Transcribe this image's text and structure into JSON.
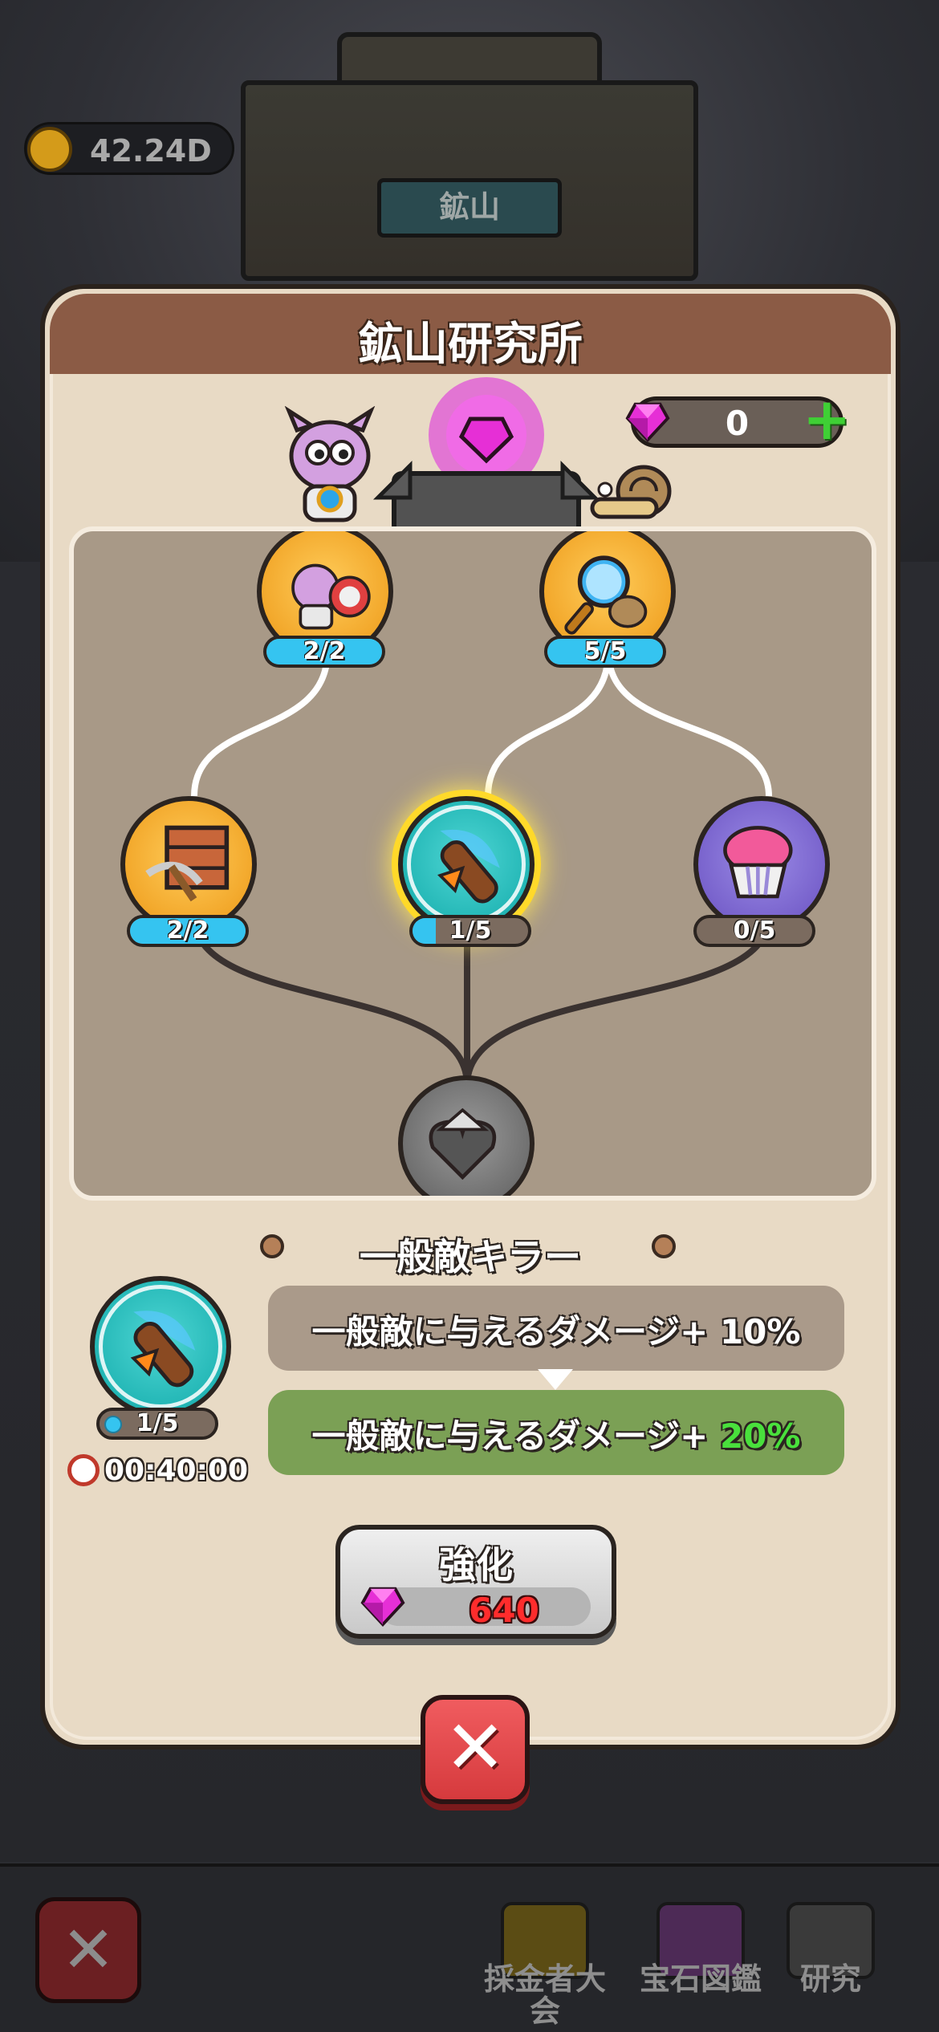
{
  "hud": {
    "coins": "42.24D",
    "mine_label": "鉱山"
  },
  "dialog": {
    "title": "鉱山研究所",
    "gem_count": "0"
  },
  "tree": {
    "nodes": [
      {
        "id": "worker-speed",
        "level": "2/2",
        "progress": 1.0,
        "color": "orange"
      },
      {
        "id": "search",
        "level": "5/5",
        "progress": 1.0,
        "color": "orange"
      },
      {
        "id": "mining",
        "level": "2/2",
        "progress": 1.0,
        "color": "orange"
      },
      {
        "id": "common-enemy-killer",
        "level": "1/5",
        "progress": 0.2,
        "color": "teal",
        "selected": true
      },
      {
        "id": "muffin",
        "level": "0/5",
        "progress": 0.0,
        "color": "purple"
      },
      {
        "id": "root",
        "color": "gray"
      }
    ]
  },
  "skill": {
    "name": "一般敵キラー",
    "level": "1/5",
    "timer": "00:40:00",
    "effect_current": "一般敵に与えるダメージ+ 10%",
    "effect_next_prefix": "一般敵に与えるダメージ+ ",
    "effect_next_value": "20%",
    "upgrade_label": "強化",
    "upgrade_cost": "640"
  },
  "bottom_nav": [
    {
      "label": "採金者大会"
    },
    {
      "label": "宝石図鑑"
    },
    {
      "label": "研究"
    }
  ],
  "colors": {
    "dialog_bg": "#e8dac5",
    "header_bg": "#8b5b45",
    "gem": "#e62fd6",
    "level_fill": "#35c4f0",
    "next_effect_bg": "#7ba055",
    "cost_red": "#ff2c2c",
    "close_red": "#e04a4d"
  }
}
